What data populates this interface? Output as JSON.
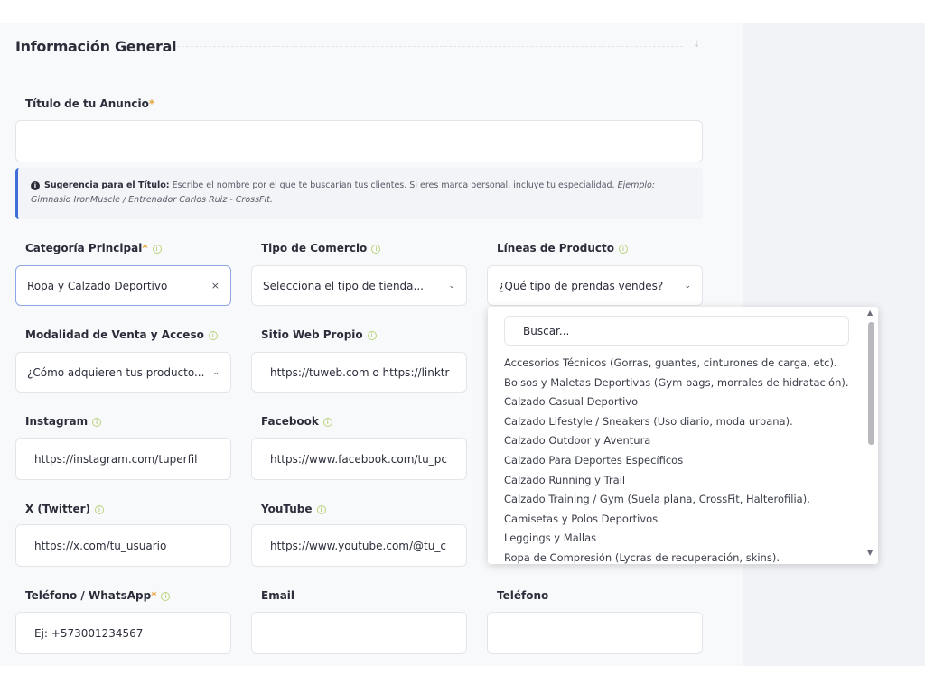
{
  "section": {
    "title": "Información General"
  },
  "title_field": {
    "label": "Título de tu Anuncio",
    "required_mark": "*",
    "value": ""
  },
  "hint": {
    "icon": "info-icon",
    "bold": "Sugerencia para el Título:",
    "text": " Escribe el nombre por el que te buscarían tus clientes. Si eres marca personal, incluye tu especialidad. ",
    "example": "Ejemplo: Gimnasio IronMuscle / Entrenador Carlos Ruiz - CrossFit."
  },
  "fields": {
    "categoria": {
      "label": "Categoría Principal",
      "required_mark": "*",
      "value": "Ropa y Calzado Deportivo",
      "clear": "×"
    },
    "tipo_comercio": {
      "label": "Tipo de Comercio",
      "placeholder": "Selecciona el tipo de tienda..."
    },
    "lineas": {
      "label": "Líneas de Producto",
      "placeholder": "¿Qué tipo de prendas vendes?"
    },
    "modalidad": {
      "label": "Modalidad de Venta y Acceso",
      "placeholder": "¿Cómo adquieren tus producto..."
    },
    "sitio_web": {
      "label": "Sitio Web Propio",
      "value": "https://tuweb.com o https://linktr"
    },
    "instagram": {
      "label": "Instagram",
      "value": "https://instagram.com/tuperfil"
    },
    "facebook": {
      "label": "Facebook",
      "value": "https://www.facebook.com/tu_pc"
    },
    "twitter": {
      "label": "X (Twitter)",
      "value": "https://x.com/tu_usuario"
    },
    "youtube": {
      "label": "YouTube",
      "value": "https://www.youtube.com/@tu_c"
    },
    "whatsapp": {
      "label": "Teléfono / WhatsApp",
      "required_mark": "*",
      "value": "Ej: +573001234567"
    },
    "email": {
      "label": "Email",
      "value": ""
    },
    "telefono": {
      "label": "Teléfono",
      "value": ""
    }
  },
  "icons": {
    "info": "i",
    "caret": "⌄",
    "arrow": "↓",
    "scroll_up": "▲",
    "scroll_down": "▼"
  },
  "dropdown": {
    "search_placeholder": "Buscar...",
    "items": [
      "Accesorios Técnicos (Gorras, guantes, cinturones de carga, etc).",
      "Bolsos y Maletas Deportivas (Gym bags, morrales de hidratación).",
      "Calzado Casual Deportivo",
      "Calzado Lifestyle / Sneakers (Uso diario, moda urbana).",
      "Calzado Outdoor y Aventura",
      "Calzado Para Deportes Específicos",
      "Calzado Running y Trail",
      "Calzado Training / Gym (Suela plana, CrossFit, Halterofilia).",
      "Camisetas y Polos Deportivos",
      "Leggings y Mallas",
      "Ropa de Compresión (Lycras de recuperación, skins)."
    ]
  },
  "colors": {
    "accent": "#3f6fd8",
    "required": "#e8a33d",
    "info": "#9cbd4f"
  }
}
